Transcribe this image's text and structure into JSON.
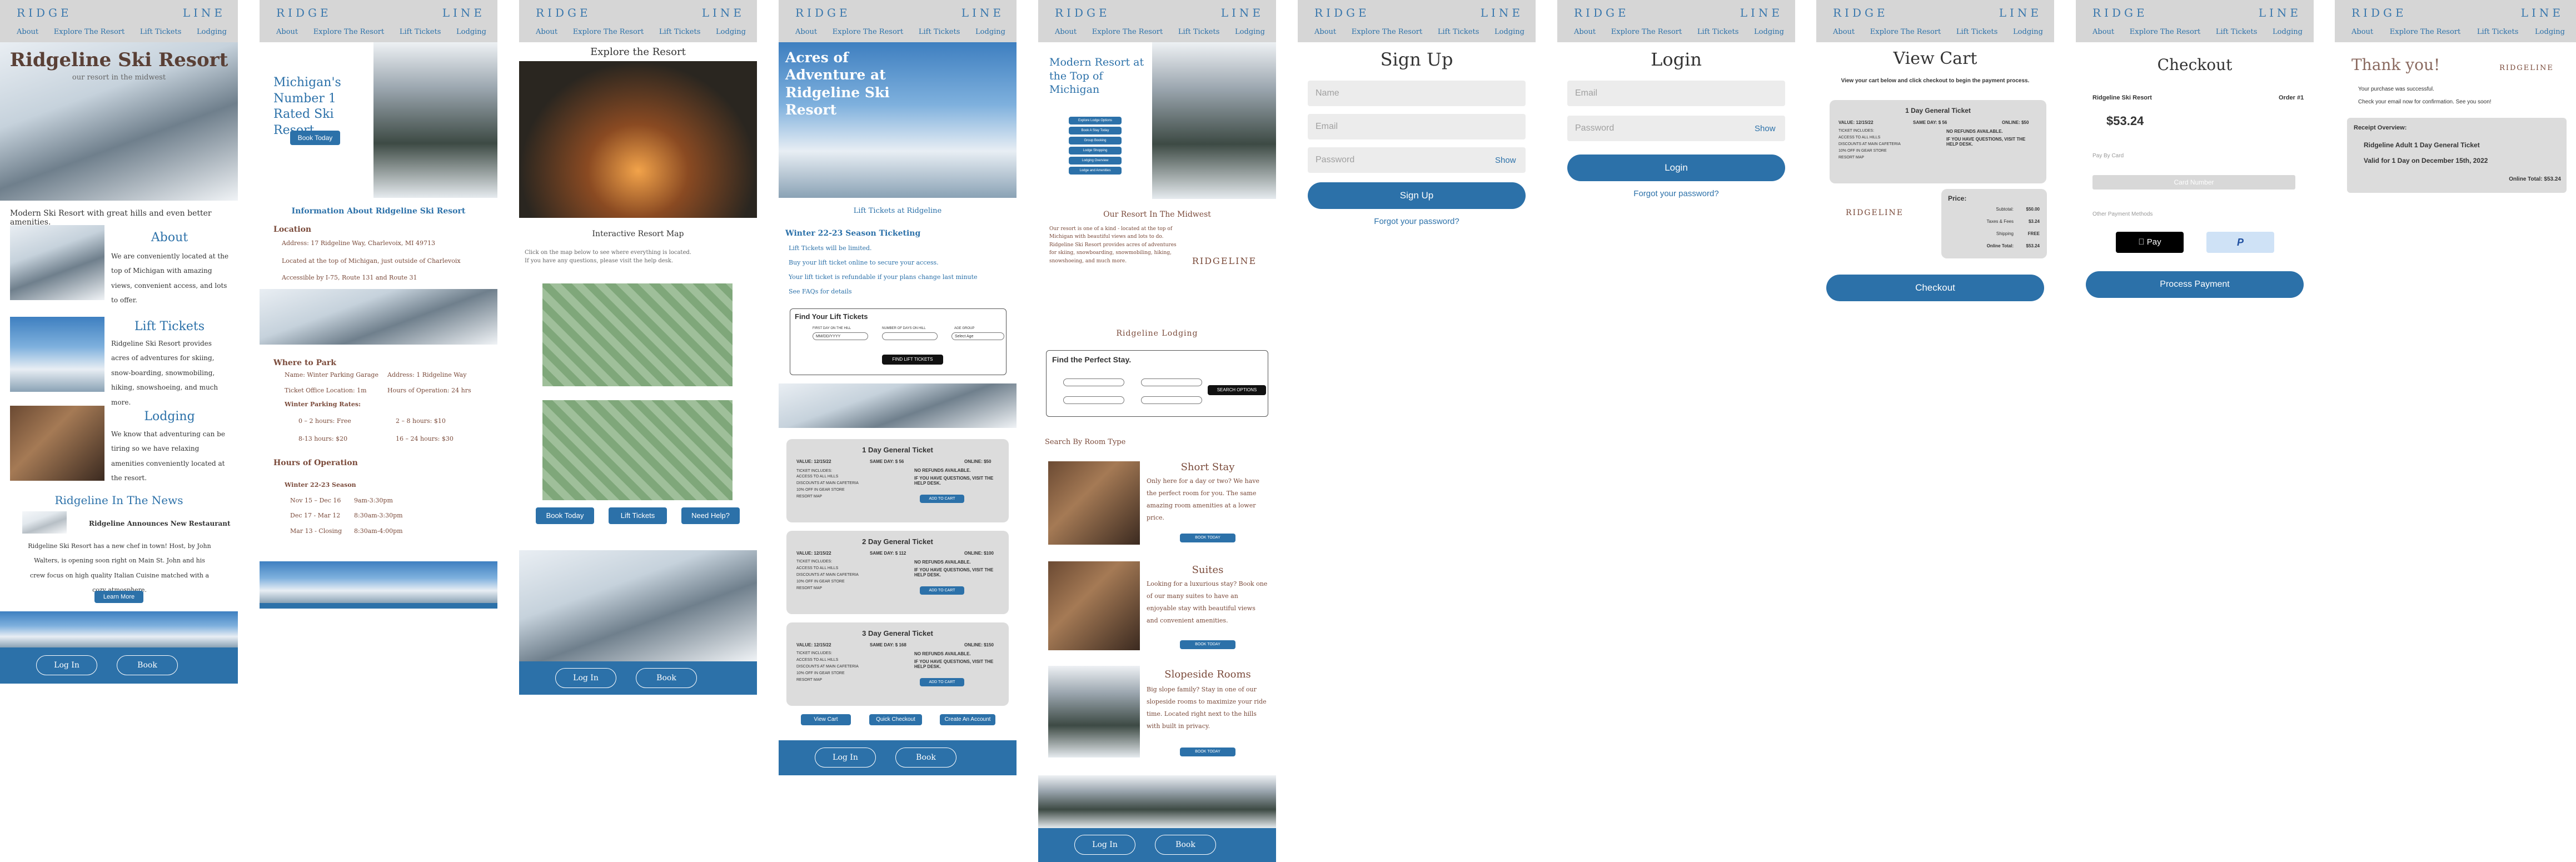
{
  "header": {
    "logo_left": "RIDGE",
    "logo_right": "LINE",
    "nav": [
      "About",
      "Explore The Resort",
      "Lift Tickets",
      "Lodging"
    ]
  },
  "footer": {
    "login": "Log In",
    "book": "Book"
  },
  "home": {
    "title": "Ridgeline Ski Resort",
    "tagline": "our resort in the midwest",
    "intro": "Modern Ski Resort with great hills and even better amenities.",
    "about_h": "About",
    "about_t": "We are conveniently located at the top of Michigan with amazing views, convenient access, and lots to offer.",
    "lift_h": "Lift Tickets",
    "lift_t": "Ridgeline Ski Resort provides acres of adventures for skiing, snow-boarding, snowmobiling, hiking, snowshoeing, and much more.",
    "lodge_h": "Lodging",
    "lodge_t": "We know that adventuring can be tiring so we have relaxing amenities conveniently located at the resort.",
    "news_h": "Ridgeline In The News",
    "news_title": "Ridgeline Announces New Restaurant",
    "news_t": "Ridgeline Ski Resort has a new chef in town! Host, by John Walters, is opening soon right on Main St. John and his crew focus on high quality Italian Cuisine matched with a cozy atmosphere.",
    "news_btn": "Learn More"
  },
  "about": {
    "hero": "Michigan's Number 1 Rated Ski Resort",
    "book_btn": "Book Today",
    "info_h": "Information About Ridgeline Ski Resort",
    "loc_h": "Location",
    "address": "Address: 17 Ridgeline Way, Charlevoix, MI 49713",
    "loc_t1": "Located at the top of Michigan, just outside of Charlevoix",
    "loc_t2": "Accessible by I-75, Route 131 and Route 31",
    "park_h": "Where to Park",
    "park_name": "Name: Winter Parking Garage",
    "park_addr": "Address: 1 Ridgeline Way",
    "office": "Ticket Office Location: 1m",
    "hours_op": "Hours of Operation: 24 hrs",
    "rates_h": "Winter Parking Rates:",
    "rates": [
      "0 – 2 hours: Free",
      "2 – 8 hours: $10",
      "8-13 hours: $20",
      "16 – 24 hours: $30"
    ],
    "hours_h": "Hours of Operation",
    "season": "Winter 22-23 Season",
    "hours": [
      "Nov 15 – Dec 16",
      "9am-3:30pm",
      "Dec 17 - Mar 12",
      "8:30am-3:30pm",
      "Mar 13 - Closing",
      "8:30am-4:00pm"
    ]
  },
  "explore": {
    "title": "Explore the Resort",
    "map_h": "Interactive Resort Map",
    "map_t": "Click on the map below to see where everything is located. If you have any questions, please visit the help desk.",
    "btns": [
      "Book Today",
      "Lift Tickets",
      "Need Help?"
    ]
  },
  "tickets": {
    "hero": "Acres of Adventure at Ridgeline Ski Resort",
    "sub": "Lift Tickets at Ridgeline",
    "season_h": "Winter 22-23 Season Ticketing",
    "lines": [
      "Lift Tickets will be limited.",
      "Buy your lift ticket online to secure your access.",
      "Your lift ticket is refundable if your plans change last minute",
      "See FAQs for details"
    ],
    "find_h": "Find Your Lift Tickets",
    "find_btn": "FIND LIFT TICKETS",
    "f1": "FIRST DAY ON THE HILL",
    "f2": "NUMBER OF DAYS ON HILL",
    "f3": "AGE GROUP",
    "f1v": "MM/DD/YYYY",
    "f3v": "Select Age",
    "cards": [
      {
        "title": "1 Day General Ticket",
        "value": "VALUE: 12/15/22",
        "same": "SAME DAY: $ 56",
        "online": "ONLINE: $50"
      },
      {
        "title": "2 Day General Ticket",
        "value": "VALUE: 12/15/22",
        "same": "SAME DAY: $ 112",
        "online": "ONLINE: $100"
      },
      {
        "title": "3 Day General Ticket",
        "value": "VALUE: 12/15/22",
        "same": "SAME DAY: $ 168",
        "online": "ONLINE: $150"
      }
    ],
    "card_lines": [
      "TICKET INCLUDES:",
      "ACCESS TO ALL HILLS",
      "DISCOUNTS AT MAIN CAFETERIA",
      "10% OFF IN GEAR STORE",
      "RESORT MAP"
    ],
    "no_refund": "NO REFUNDS AVAILABLE.",
    "question": "IF YOU HAVE QUESTIONS, VISIT THE HELP DESK.",
    "add": "ADD TO CART",
    "btns": [
      "View Cart",
      "Quick Checkout",
      "Create An Account"
    ]
  },
  "lodging": {
    "hero": "Modern Resort at the Top of Michigan",
    "menu": [
      "Explore Lodge Options",
      "Book A Stay Today",
      "Group Booking",
      "Lodge Shopping",
      "Lodging Overview",
      "Lodge and Amenities"
    ],
    "resort_h": "Our Resort In The Midwest",
    "resort_t": "Our resort is one of a kind - located at the top of Michigan with beautiful views and lots to do. Ridgeline Ski Resort provides acres of adventures for skiing, snowboarding, snowmobiling, hiking, snowshoeing, and much more.",
    "brand": "RIDGELINE",
    "lodging_h": "Ridgeline Lodging",
    "find_h": "Find the Perfect Stay.",
    "search": "SEARCH OPTIONS",
    "by_type": "Search By Room Type",
    "rooms": [
      {
        "name": "Short Stay",
        "text": "Only here for a day or two? We have the perfect room for you. The same amazing room amenities at a lower price."
      },
      {
        "name": "Suites",
        "text": "Looking for a luxurious stay? Book one of our many suites to have an enjoyable stay with beautiful views and convenient amenities."
      },
      {
        "name": "Slopeside Rooms",
        "text": "Big slope family? Stay in one of our slopeside rooms to maximize your ride time. Located right next to the hills with built in privacy."
      }
    ],
    "book_now": "BOOK TODAY"
  },
  "signup": {
    "title": "Sign Up",
    "name": "Name",
    "email": "Email",
    "password": "Password",
    "show": "Show",
    "btn": "Sign Up",
    "forgot": "Forgot your password?"
  },
  "login": {
    "title": "Login",
    "email": "Email",
    "password": "Password",
    "show": "Show",
    "btn": "Login",
    "forgot": "Forgot your password?"
  },
  "cart": {
    "title": "View Cart",
    "sub": "View your cart below and click checkout to begin the payment process.",
    "ticket": "1 Day General Ticket",
    "value": "VALUE: 12/15/22",
    "same": "SAME DAY: $ 56",
    "online": "ONLINE: $50",
    "price_h": "Price:",
    "rows": [
      [
        "Subtotal:",
        "$50.00"
      ],
      [
        "Taxes & Fees",
        "$3.24"
      ],
      [
        "Shipping",
        "FREE"
      ],
      [
        "Online Total:",
        "$53.24"
      ]
    ],
    "brand": "RIDGELINE",
    "checkout": "Checkout"
  },
  "checkout": {
    "title": "Checkout",
    "merchant": "Ridgeline Ski Resort",
    "order": "Order #1",
    "amount": "$53.24",
    "card": "Pay By Card",
    "card_num": "Card Number",
    "other": "Other Payment Methods",
    "apple": "Pay",
    "paypal": "P",
    "btn": "Process Payment"
  },
  "thanks": {
    "title": "Thank you!",
    "l1": "Your purchase was successful.",
    "l2": "Check your email now for confirmation. See you soon!",
    "overview": "Receipt Overview:",
    "item": "Ridgeline Adult 1 Day General Ticket",
    "valid": "Valid for 1 Day on December 15th, 2022",
    "total": "Online Total: $53.24"
  }
}
